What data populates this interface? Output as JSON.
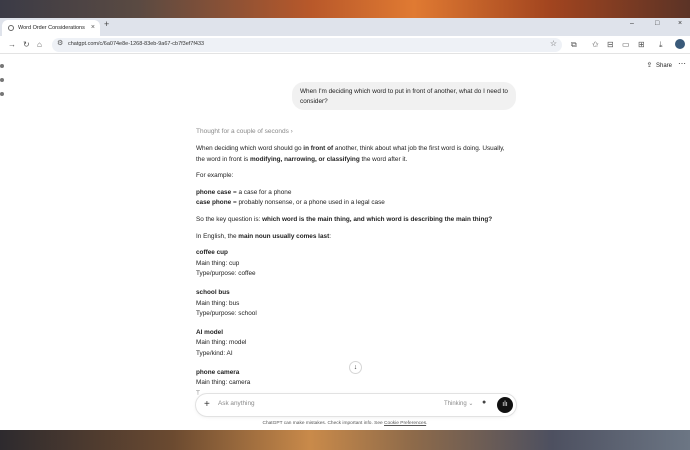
{
  "browser": {
    "tab_title": "Word Order Considerations",
    "tab_close": "×",
    "new_tab": "+",
    "url": "chatgpt.com/c/6a074e8e-1268-83eb-9a67-cb7f3ef7f433",
    "window_controls": [
      "–",
      "□",
      "×"
    ]
  },
  "header": {
    "share_label": "Share",
    "share_icon": "share-icon",
    "more_icon": "more-icon"
  },
  "user_message": "When I'm deciding which word to put in front of another, what do I need to consider?",
  "assistant": {
    "thought_label": "Thought for a couple of seconds ›",
    "intro_1": "When deciding which word should go ",
    "intro_bold_1": "in front of",
    "intro_2": " another, think about what job the first word is doing. Usually, the word in front is ",
    "intro_bold_2": "modifying, narrowing, or classifying",
    "intro_3": " the word after it.",
    "for_example": "For example:",
    "ex1_bold": "phone case",
    "ex1_rest": " = a case for a phone",
    "ex2_bold": "case phone",
    "ex2_rest": " = probably nonsense, or a phone used in a legal case",
    "key_q_1": "So the key question is: ",
    "key_q_bold": "which word is the main thing, and which word is describing the main thing?",
    "english_1": "In English, the ",
    "english_bold": "main noun usually comes last",
    "english_2": ":",
    "examples": [
      {
        "title": "coffee cup",
        "line1": "Main thing: cup",
        "line2": "Type/purpose: coffee"
      },
      {
        "title": "school bus",
        "line1": "Main thing: bus",
        "line2": "Type/purpose: school"
      },
      {
        "title": "AI model",
        "line1": "Main thing: model",
        "line2": "Type/kind: AI"
      },
      {
        "title": "phone camera",
        "line1": "Main thing: camera",
        "line2": "T"
      }
    ]
  },
  "composer": {
    "placeholder": "Ask anything",
    "model_label": "Thinking ⌄",
    "plus": "+",
    "mic": "🎤",
    "voice": "ılı"
  },
  "disclaimer": {
    "text": "ChatGPT can make mistakes. Check important info. See ",
    "link": "Cookie Preferences",
    "end": "."
  },
  "scroll_arrow": "↓"
}
